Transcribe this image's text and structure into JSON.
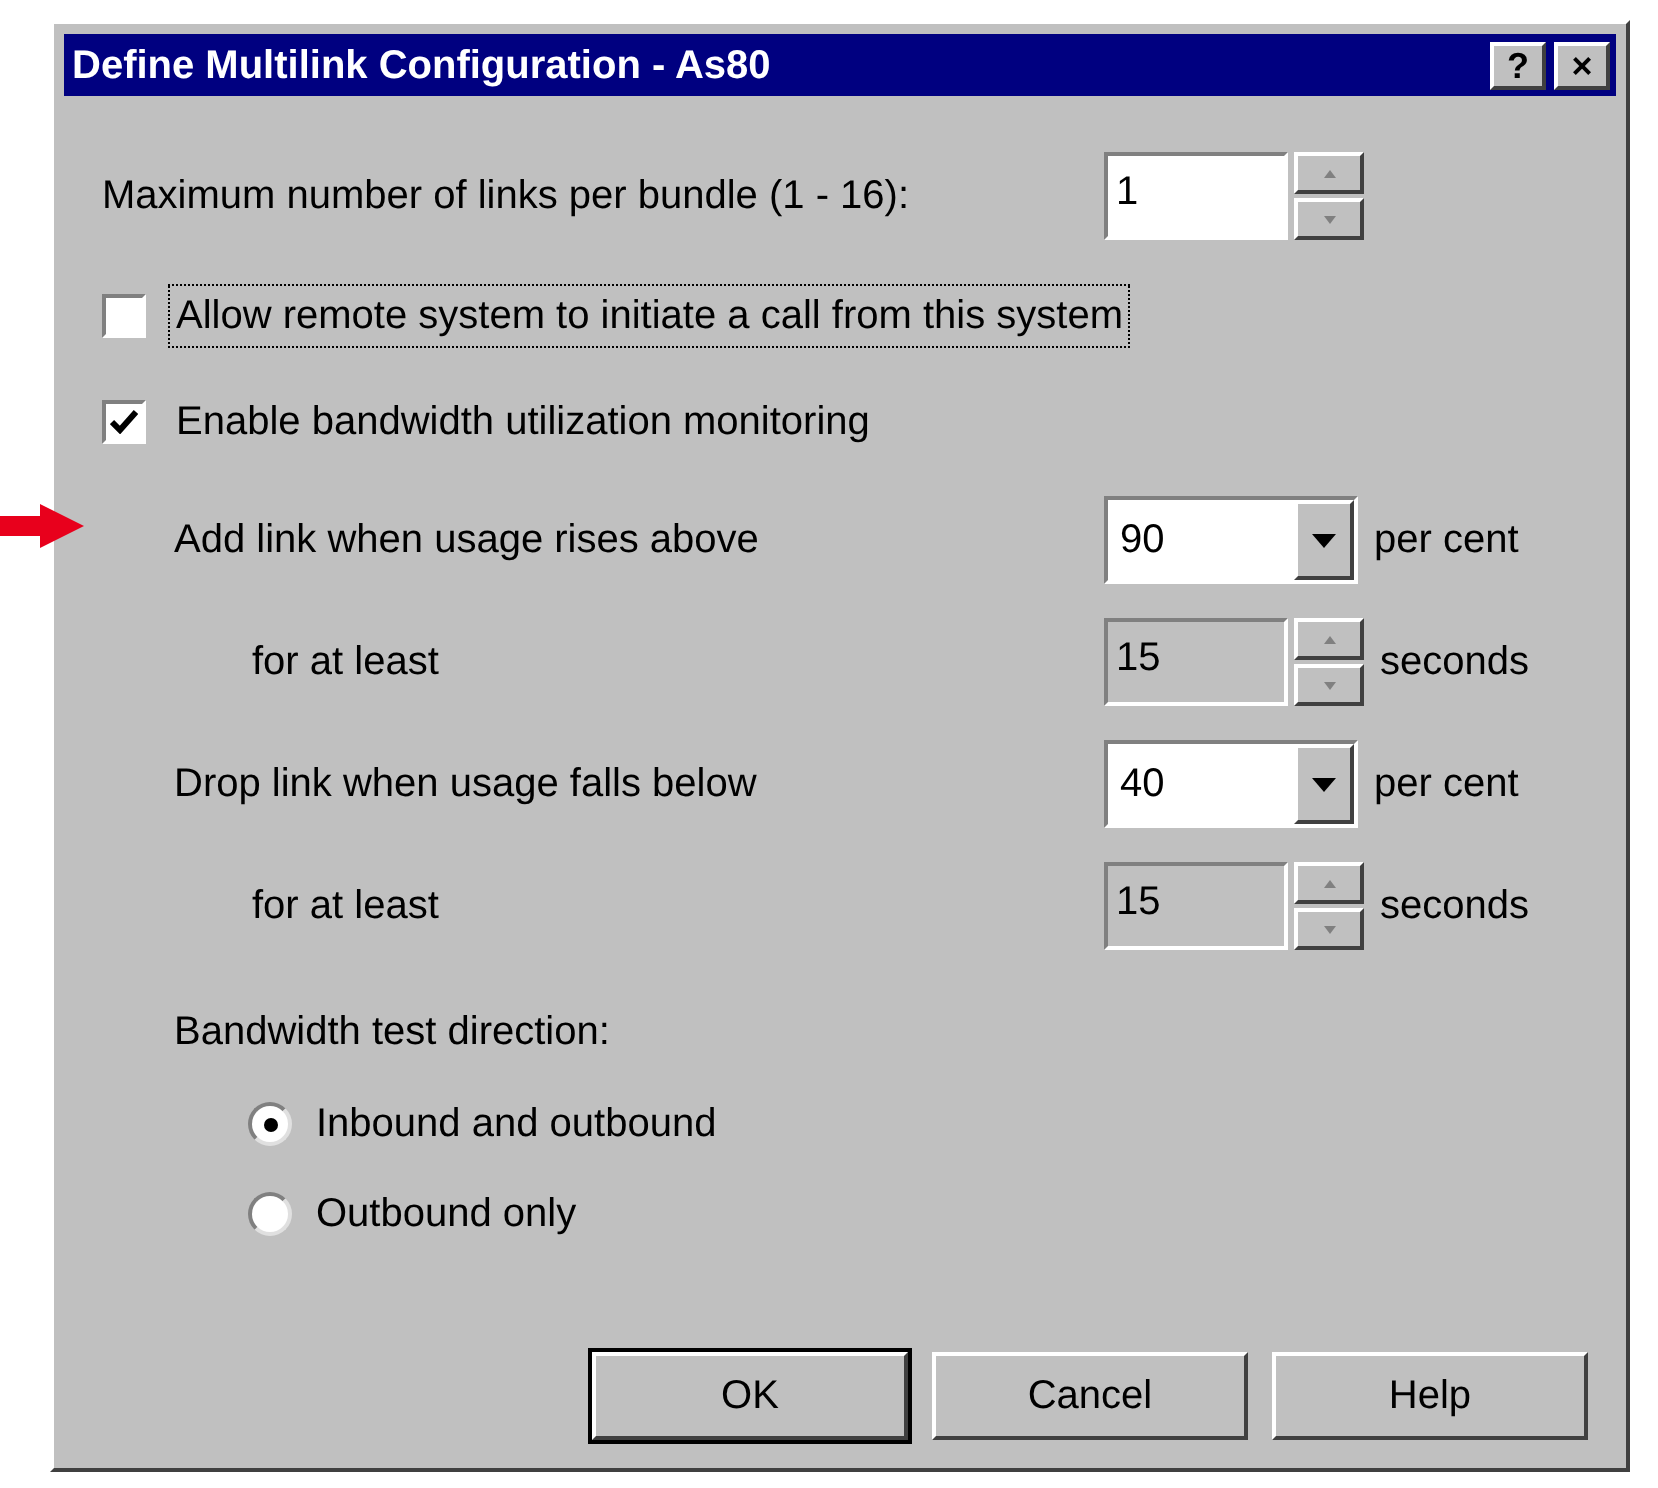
{
  "window": {
    "title": "Define Multilink Configuration - As80",
    "title_buttons": [
      "?",
      "×"
    ]
  },
  "max_links": {
    "label": "Maximum number of links per bundle (1 - 16):",
    "value": "1"
  },
  "checkboxes": [
    {
      "label": "Allow remote system to initiate a call from this system",
      "checked": false,
      "focused": true
    },
    {
      "label": "Enable bandwidth utilization monitoring",
      "checked": true,
      "focused": false
    }
  ],
  "thresholds": [
    {
      "kind": "combo",
      "label": "Add link when usage rises above",
      "value": "90",
      "unit": "per cent"
    },
    {
      "kind": "spin",
      "label": "for at least",
      "value": "15",
      "unit": "seconds",
      "disabled": true
    },
    {
      "kind": "combo",
      "label": "Drop link when usage falls below",
      "value": "40",
      "unit": "per cent"
    },
    {
      "kind": "spin",
      "label": "for at least",
      "value": "15",
      "unit": "seconds",
      "disabled": true
    }
  ],
  "direction": {
    "label": "Bandwidth test direction:",
    "options": [
      {
        "label": "Inbound and outbound",
        "selected": true
      },
      {
        "label": "Outbound only",
        "selected": false
      }
    ]
  },
  "buttons": [
    {
      "label": "OK",
      "default": true
    },
    {
      "label": "Cancel",
      "default": false
    },
    {
      "label": "Help",
      "default": false
    }
  ]
}
